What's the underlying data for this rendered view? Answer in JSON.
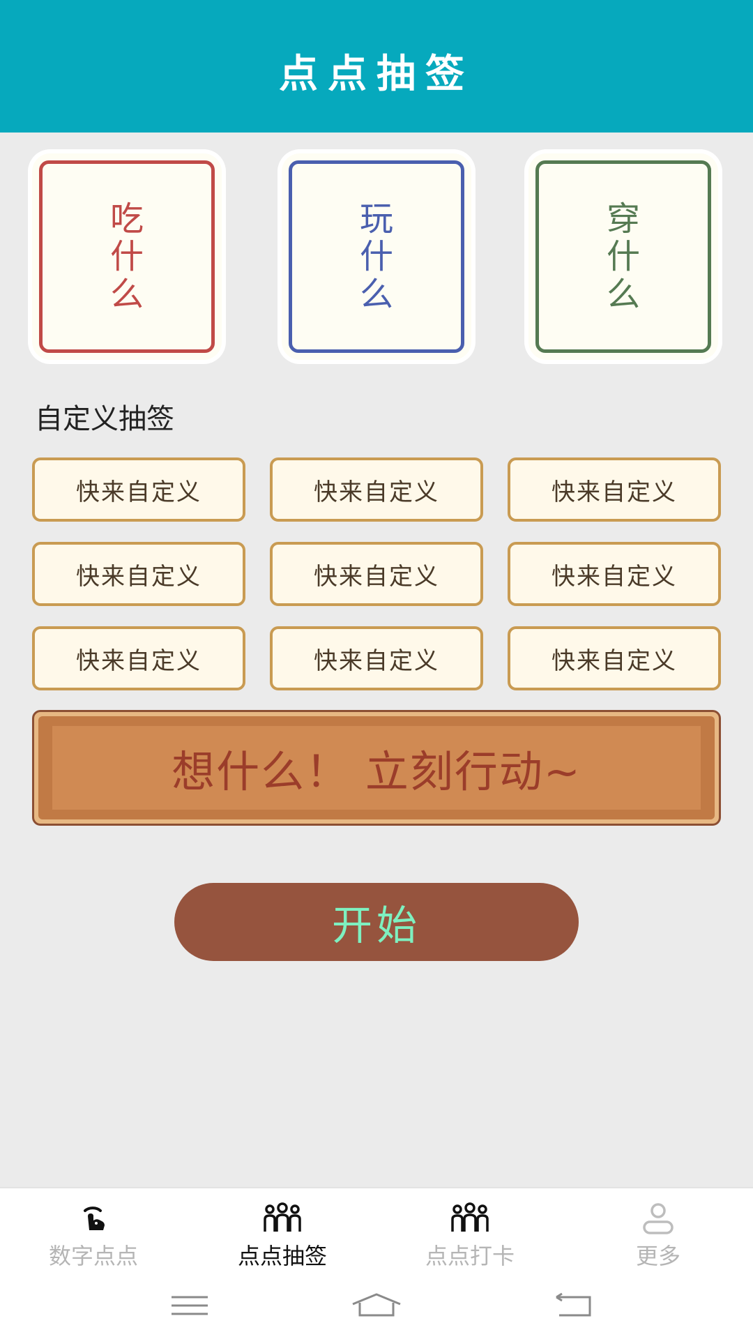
{
  "header": {
    "title": "点点抽签"
  },
  "categories": [
    {
      "label": "吃什么",
      "color": "#c04a47"
    },
    {
      "label": "玩什么",
      "color": "#4a5fae"
    },
    {
      "label": "穿什么",
      "color": "#557a52"
    }
  ],
  "custom": {
    "section_title": "自定义抽签",
    "items": [
      "快来自定义",
      "快来自定义",
      "快来自定义",
      "快来自定义",
      "快来自定义",
      "快来自定义",
      "快来自定义",
      "快来自定义",
      "快来自定义"
    ]
  },
  "banner": {
    "text": "想什么！ 立刻行动~"
  },
  "start": {
    "label": "开始"
  },
  "tabbar": {
    "items": [
      {
        "label": "数字点点",
        "icon": "tap-icon",
        "active": false
      },
      {
        "label": "点点抽签",
        "icon": "people-icon",
        "active": true
      },
      {
        "label": "点点打卡",
        "icon": "people-icon",
        "active": false
      },
      {
        "label": "更多",
        "icon": "user-icon",
        "active": false
      }
    ]
  },
  "colors": {
    "header": "#06a9bd",
    "start_button": "#96543e",
    "start_text": "#7ef0c0",
    "custom_border": "#c99b52"
  }
}
